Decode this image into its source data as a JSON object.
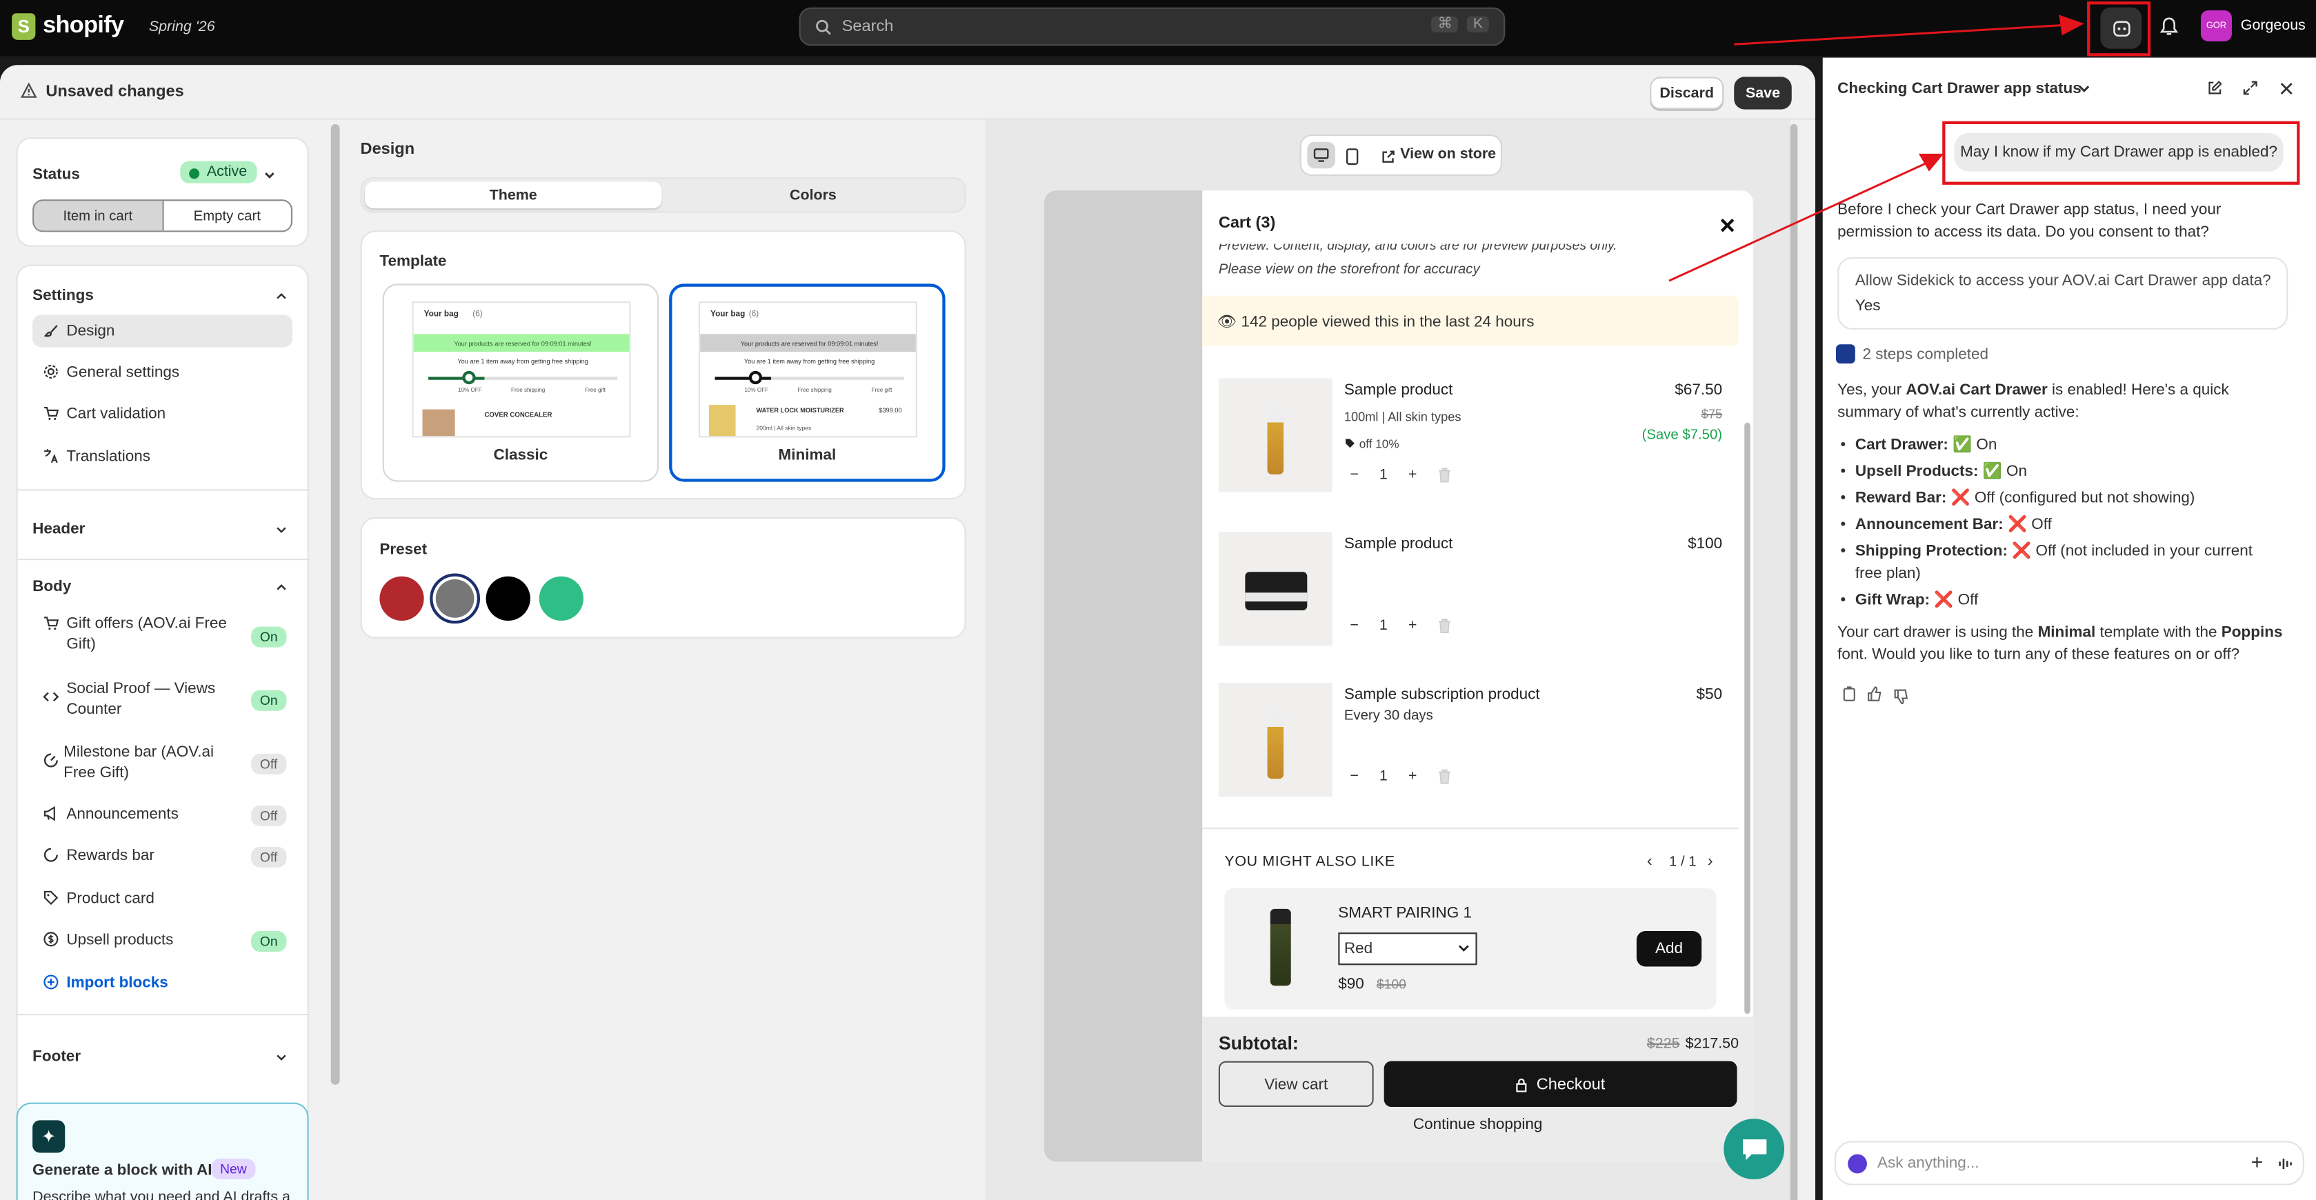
{
  "topbar": {
    "brand": "shopify",
    "edition": "Spring '26",
    "search_placeholder": "Search",
    "kbd_cmd": "⌘",
    "kbd_k": "K",
    "store_initials": "GOR",
    "store_name": "Gorgeous"
  },
  "page_header": {
    "title": "Unsaved changes",
    "discard": "Discard",
    "save": "Save"
  },
  "left": {
    "status_label": "Status",
    "status_value": "Active",
    "toggle_item": "Item in cart",
    "toggle_empty": "Empty cart",
    "settings_title": "Settings",
    "settings_items": [
      "Design",
      "General settings",
      "Cart validation",
      "Translations"
    ],
    "header_title": "Header",
    "body_title": "Body",
    "body_items": [
      {
        "label": "Gift offers (AOV.ai Free Gift)",
        "state": "On"
      },
      {
        "label": "Social Proof — Views Counter",
        "state": "On"
      },
      {
        "label": "Milestone bar (AOV.ai Free Gift)",
        "state": "Off"
      },
      {
        "label": "Announcements",
        "state": "Off"
      },
      {
        "label": "Rewards bar",
        "state": "Off"
      },
      {
        "label": "Product card",
        "state": ""
      },
      {
        "label": "Upsell products",
        "state": "On"
      }
    ],
    "import_blocks": "Import blocks",
    "footer_title": "Footer",
    "ai_title": "Generate a block with AI",
    "ai_badge": "New",
    "ai_desc": "Describe what you need and AI drafts a"
  },
  "design": {
    "title": "Design",
    "tab_theme": "Theme",
    "tab_colors": "Colors",
    "template_title": "Template",
    "templates": [
      {
        "name": "Classic",
        "bag": "Your bag",
        "count": "(6)",
        "reserved": "Your products are reserved for 09:09:01 minutes!",
        "away": "You are 1 item away from getting free shipping",
        "steps": [
          "10% OFF",
          "Free shipping",
          "Free gift"
        ],
        "product": "COVER CONCEALER",
        "price": ""
      },
      {
        "name": "Minimal",
        "bag": "Your bag",
        "count": "(6)",
        "reserved": "Your products are reserved for 09:09:01 minutes!",
        "away": "You are 1 item away from getting free shipping",
        "steps": [
          "10% OFF",
          "Free shipping",
          "Free gift"
        ],
        "product": "WATER LOCK MOISTURIZER",
        "price": "$399.00",
        "variant": "200ml | All skin types"
      }
    ],
    "preset_title": "Preset",
    "presets": [
      "#b3282d",
      "#777777",
      "#000000",
      "#2fbf86"
    ]
  },
  "preview": {
    "view_on_store": "View on store",
    "cart_title": "Cart (3)",
    "notice_line1": "Preview: Content, display, and colors are for preview purposes only.",
    "notice_line2": "Please view on the storefront for accuracy",
    "views_banner": "👁 142 people viewed this in the last 24 hours",
    "items": [
      {
        "name": "Sample product",
        "variant": "100ml | All skin types",
        "discount": "off 10%",
        "price": "$67.50",
        "compare": "$75",
        "save": "(Save $7.50)",
        "qty": "1"
      },
      {
        "name": "Sample product",
        "variant": "",
        "discount": "",
        "price": "$100",
        "compare": "",
        "save": "",
        "qty": "1"
      },
      {
        "name": "Sample subscription product",
        "variant": "Every 30 days",
        "discount": "",
        "price": "$50",
        "compare": "",
        "save": "",
        "qty": "1"
      }
    ],
    "upsell_title": "YOU MIGHT ALSO LIKE",
    "upsell_pager": "1 / 1",
    "upsell_name": "SMART PAIRING 1",
    "upsell_variant": "Red",
    "upsell_price": "$90",
    "upsell_compare": "$100",
    "upsell_add": "Add",
    "subtotal_label": "Subtotal:",
    "subtotal_compare": "$225",
    "subtotal_value": "$217.50",
    "view_cart": "View cart",
    "checkout": "Checkout",
    "continue": "Continue shopping"
  },
  "sidekick": {
    "title": "Checking Cart Drawer app status",
    "user_msg": "May I know if my Cart Drawer app is enabled?",
    "reply1": "Before I check your Cart Drawer app status, I need your permission to access its data. Do you consent to that?",
    "permission_q": "Allow Sidekick to access your AOV.ai Cart Drawer app data?",
    "permission_a": "Yes",
    "steps": "2 steps completed",
    "summary_a": "Yes, your ",
    "summary_b": "AOV.ai Cart Drawer",
    "summary_c": " is enabled! Here's a quick summary of what's currently active:",
    "bullets": [
      {
        "k": "Cart Drawer:",
        "v": " ✅ On"
      },
      {
        "k": "Upsell Products:",
        "v": " ✅ On"
      },
      {
        "k": "Reward Bar:",
        "v": " ❌ Off (configured but not showing)"
      },
      {
        "k": "Announcement Bar:",
        "v": " ❌ Off"
      },
      {
        "k": "Shipping Protection:",
        "v": " ❌ Off (not included in your current free plan)"
      },
      {
        "k": "Gift Wrap:",
        "v": " ❌ Off"
      }
    ],
    "closing_a": "Your cart drawer is using the ",
    "closing_b": "Minimal",
    "closing_c": " template with the ",
    "closing_d": "Poppins",
    "closing_e": " font. Would you like to turn any of these features on or off?",
    "input_placeholder": "Ask anything..."
  },
  "colors": {
    "accent": "#005bd3",
    "annotation": "#e3141c",
    "success": "#0c5132"
  }
}
